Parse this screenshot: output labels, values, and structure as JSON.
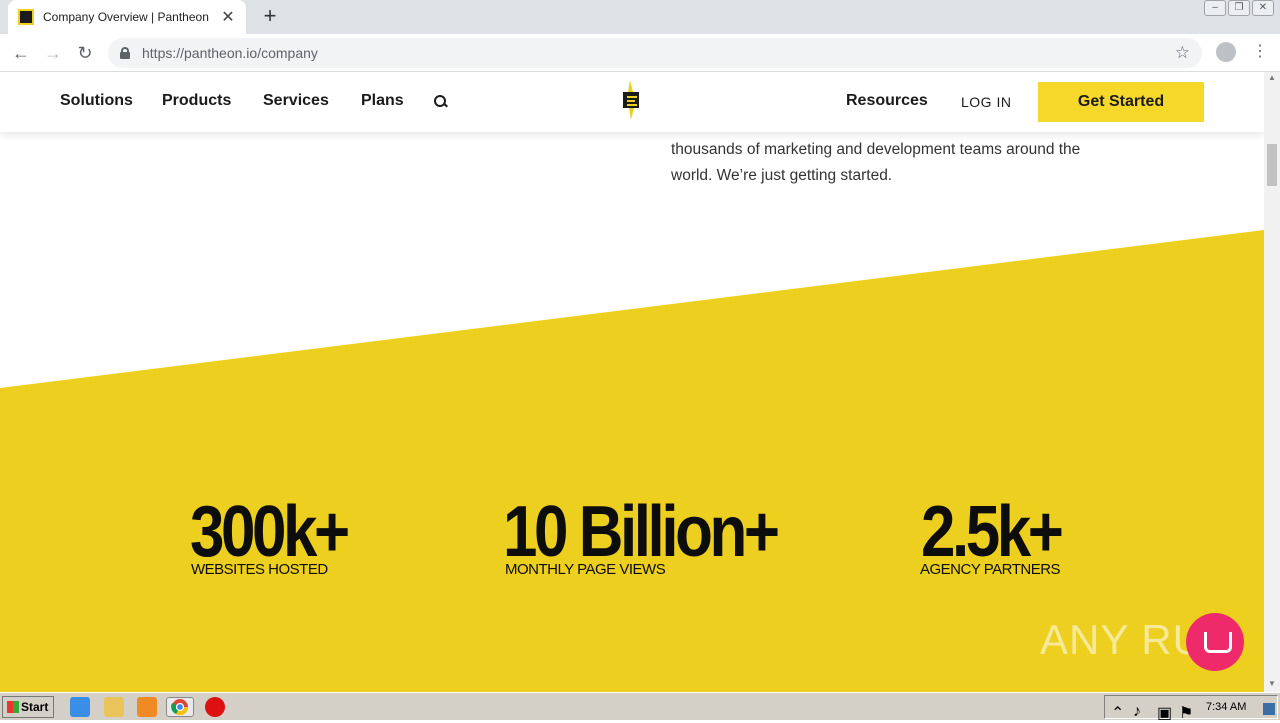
{
  "browser": {
    "tab_title": "Company Overview | Pantheon",
    "url": "https://pantheon.io/company",
    "close_glyph": "✕",
    "newtab_glyph": "+"
  },
  "site_nav": {
    "left_links": [
      "Solutions",
      "Products",
      "Services",
      "Plans"
    ],
    "right_link": "Resources",
    "login": "LOG IN",
    "cta": "Get Started"
  },
  "intro_text": "thousands of marketing and development teams around the world. We’re just getting started.",
  "stats": [
    {
      "value": "300k+",
      "label": "WEBSITES HOSTED"
    },
    {
      "value": "10 Billion+",
      "label": "MONTHLY PAGE VIEWS"
    },
    {
      "value": "2.5k+",
      "label": "AGENCY PARTNERS"
    }
  ],
  "watermark": "ANY RUN",
  "taskbar": {
    "start": "Start",
    "clock": "7:34 AM"
  },
  "colors": {
    "brand_yellow": "#EDCF1F",
    "cta_yellow": "#F5D82A",
    "chat_pink": "#EE2A6A"
  }
}
